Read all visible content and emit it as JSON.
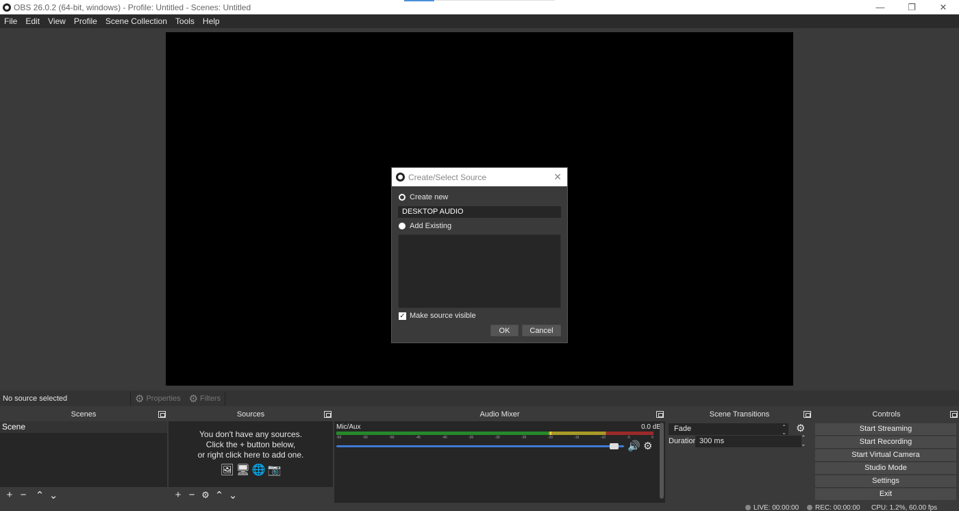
{
  "window": {
    "title": "OBS 26.0.2 (64-bit, windows) - Profile: Untitled - Scenes: Untitled",
    "minimize": "—",
    "restore": "❐",
    "close": "✕"
  },
  "menu": [
    "File",
    "Edit",
    "View",
    "Profile",
    "Scene Collection",
    "Tools",
    "Help"
  ],
  "dialog": {
    "title": "Create/Select Source",
    "close": "✕",
    "create_new": "Create new",
    "name_value": "DESKTOP AUDIO",
    "add_existing": "Add Existing",
    "make_visible": "Make source visible",
    "ok": "OK",
    "cancel": "Cancel"
  },
  "source_toolbar": {
    "no_source": "No source selected",
    "properties": "Properties",
    "filters": "Filters"
  },
  "scenes": {
    "header": "Scenes",
    "items": [
      "Scene"
    ]
  },
  "sources": {
    "header": "Sources",
    "empty_line1": "You don't have any sources.",
    "empty_line2": "Click the + button below,",
    "empty_line3": "or right click here to add one."
  },
  "audio_mixer": {
    "header": "Audio Mixer",
    "channel": "Mic/Aux",
    "level": "0.0 dB",
    "scale": [
      "-60",
      "-55",
      "-50",
      "-45",
      "-40",
      "-35",
      "-30",
      "-25",
      "-20",
      "-15",
      "-10",
      "-5",
      "0"
    ],
    "volume_fraction": 0.98
  },
  "scene_transitions": {
    "header": "Scene Transitions",
    "transition": "Fade",
    "duration_label": "Duration",
    "duration_value": "300 ms"
  },
  "controls": {
    "header": "Controls",
    "start_streaming": "Start Streaming",
    "start_recording": "Start Recording",
    "start_virtual_camera": "Start Virtual Camera",
    "studio_mode": "Studio Mode",
    "settings": "Settings",
    "exit": "Exit"
  },
  "status": {
    "live": "LIVE: 00:00:00",
    "rec": "REC: 00:00:00",
    "cpu": "CPU: 1.2%, 60.00 fps"
  }
}
